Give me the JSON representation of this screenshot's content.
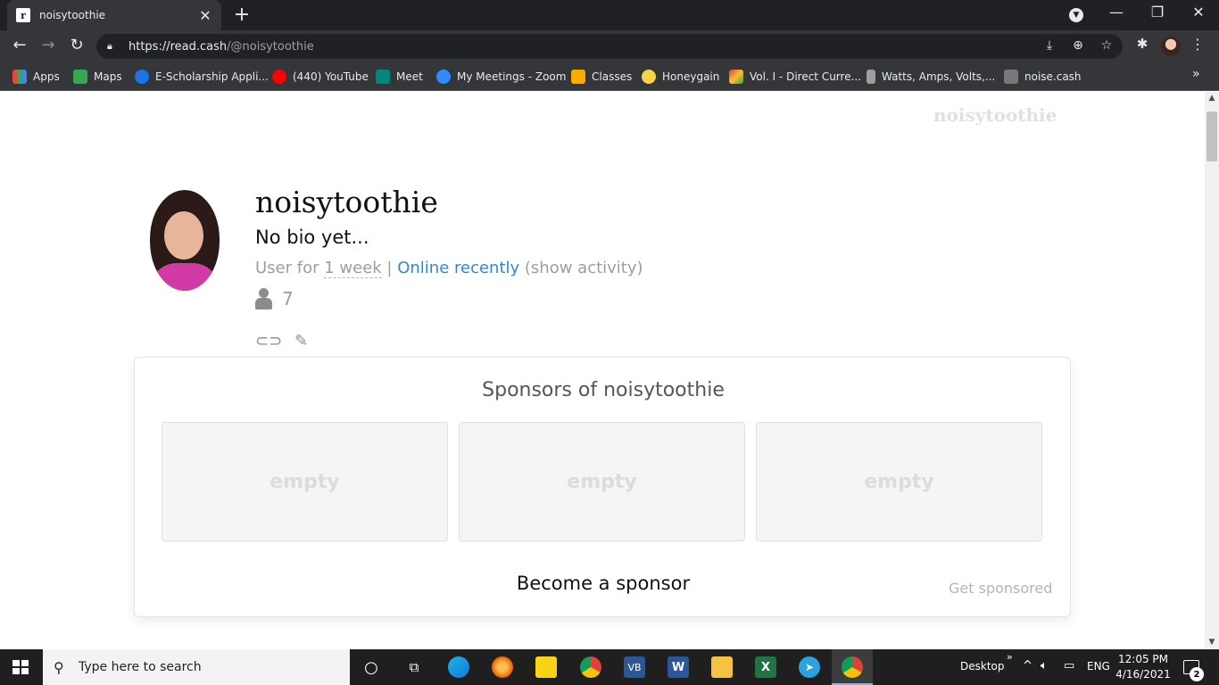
{
  "browser": {
    "tab_title": "noisytoothie",
    "tab_favicon": "r",
    "url_host": "https://read.cash",
    "url_path": "/@noisytoothie",
    "bookmarks": [
      {
        "label": "Apps",
        "color": "#e8453c"
      },
      {
        "label": "Maps",
        "color": "#34a853"
      },
      {
        "label": "E-Scholarship Appli...",
        "color": "#1a73e8"
      },
      {
        "label": "(440) YouTube",
        "color": "#ff0000"
      },
      {
        "label": "Meet",
        "color": "#00897b"
      },
      {
        "label": "My Meetings - Zoom",
        "color": "#2d8cff"
      },
      {
        "label": "Classes",
        "color": "#f9ab00"
      },
      {
        "label": "Honeygain",
        "color": "#f5d547"
      },
      {
        "label": "Vol. I - Direct Curre...",
        "color": "#e53935"
      },
      {
        "label": "Watts, Amps, Volts,...",
        "color": "#9e9e9e"
      },
      {
        "label": "noise.cash",
        "color": "#777777"
      }
    ]
  },
  "page": {
    "brand": "noisytoothie",
    "username": "noisytoothie",
    "bio": "No bio yet...",
    "meta_prefix": "User for ",
    "meta_duration": "1 week",
    "meta_sep": " | ",
    "meta_online": "Online recently",
    "meta_activity": " (show activity)",
    "followers_count": "7",
    "sponsors_title": "Sponsors of noisytoothie",
    "sponsor_slots": [
      "empty",
      "empty",
      "empty"
    ],
    "become_sponsor": "Become a sponsor",
    "get_sponsored": "Get sponsored"
  },
  "taskbar": {
    "search_placeholder": "Type here to search",
    "desktop_label": "Desktop",
    "language": "ENG",
    "time": "12:05 PM",
    "date": "4/16/2021",
    "notification_count": "2"
  }
}
